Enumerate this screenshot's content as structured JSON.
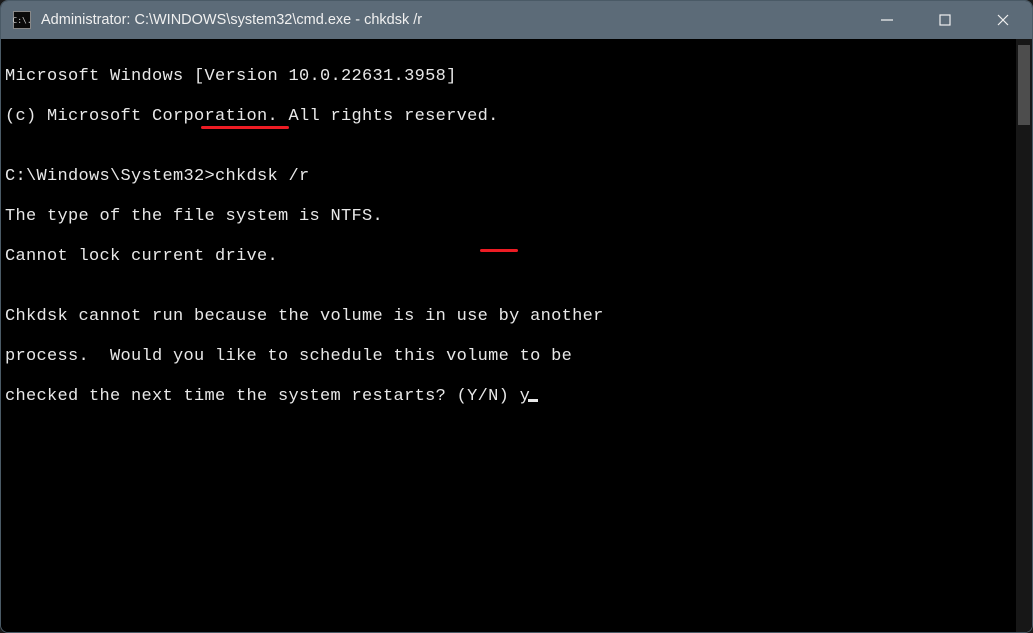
{
  "titlebar": {
    "icon_text": "C:\\.",
    "title": "Administrator: C:\\WINDOWS\\system32\\cmd.exe - chkdsk  /r"
  },
  "terminal": {
    "line1": "Microsoft Windows [Version 10.0.22631.3958]",
    "line2": "(c) Microsoft Corporation. All rights reserved.",
    "blank1": "",
    "prompt_path": "C:\\Windows\\System32>",
    "command": "chkdsk /r",
    "line4": "The type of the file system is NTFS.",
    "line5": "Cannot lock current drive.",
    "blank2": "",
    "line6": "Chkdsk cannot run because the volume is in use by another",
    "line7": "process.  Would you like to schedule this volume to be",
    "line8_prefix": "checked the next time the system restarts? (Y/N) ",
    "response": "y"
  }
}
